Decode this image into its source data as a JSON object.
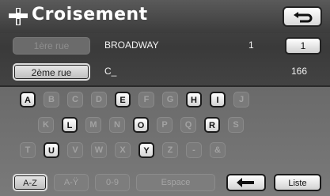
{
  "header": {
    "title": "Croisement",
    "title_icon": "intersection-icon",
    "back_icon": "back-arrow-icon"
  },
  "fields": {
    "street1": {
      "button_label": "1ère rue",
      "value": "BROADWAY",
      "number": "1",
      "number_box": "1"
    },
    "street2": {
      "button_label": "2ème rue",
      "value": "C_",
      "count": "166"
    }
  },
  "keyboard": {
    "rows": [
      [
        {
          "label": "A",
          "enabled": true
        },
        {
          "label": "B",
          "enabled": false
        },
        {
          "label": "C",
          "enabled": false
        },
        {
          "label": "D",
          "enabled": false
        },
        {
          "label": "E",
          "enabled": true
        },
        {
          "label": "F",
          "enabled": false
        },
        {
          "label": "G",
          "enabled": false
        },
        {
          "label": "H",
          "enabled": true
        },
        {
          "label": "I",
          "enabled": true
        },
        {
          "label": "J",
          "enabled": false
        }
      ],
      [
        {
          "label": "K",
          "enabled": false
        },
        {
          "label": "L",
          "enabled": true
        },
        {
          "label": "M",
          "enabled": false
        },
        {
          "label": "N",
          "enabled": false
        },
        {
          "label": "O",
          "enabled": true
        },
        {
          "label": "P",
          "enabled": false
        },
        {
          "label": "Q",
          "enabled": false
        },
        {
          "label": "R",
          "enabled": true
        },
        {
          "label": "S",
          "enabled": false
        }
      ],
      [
        {
          "label": "T",
          "enabled": false
        },
        {
          "label": "U",
          "enabled": true
        },
        {
          "label": "V",
          "enabled": false
        },
        {
          "label": "W",
          "enabled": false
        },
        {
          "label": "X",
          "enabled": false
        },
        {
          "label": "Y",
          "enabled": true
        },
        {
          "label": "Z",
          "enabled": false
        },
        {
          "label": "-",
          "enabled": false
        },
        {
          "label": "&",
          "enabled": false
        }
      ]
    ],
    "bottom": {
      "az": "A-Z",
      "ay": "A-Ÿ",
      "digits": "0-9",
      "space": "Espace",
      "backspace_icon": "backspace-arrow-icon",
      "list": "Liste"
    }
  }
}
